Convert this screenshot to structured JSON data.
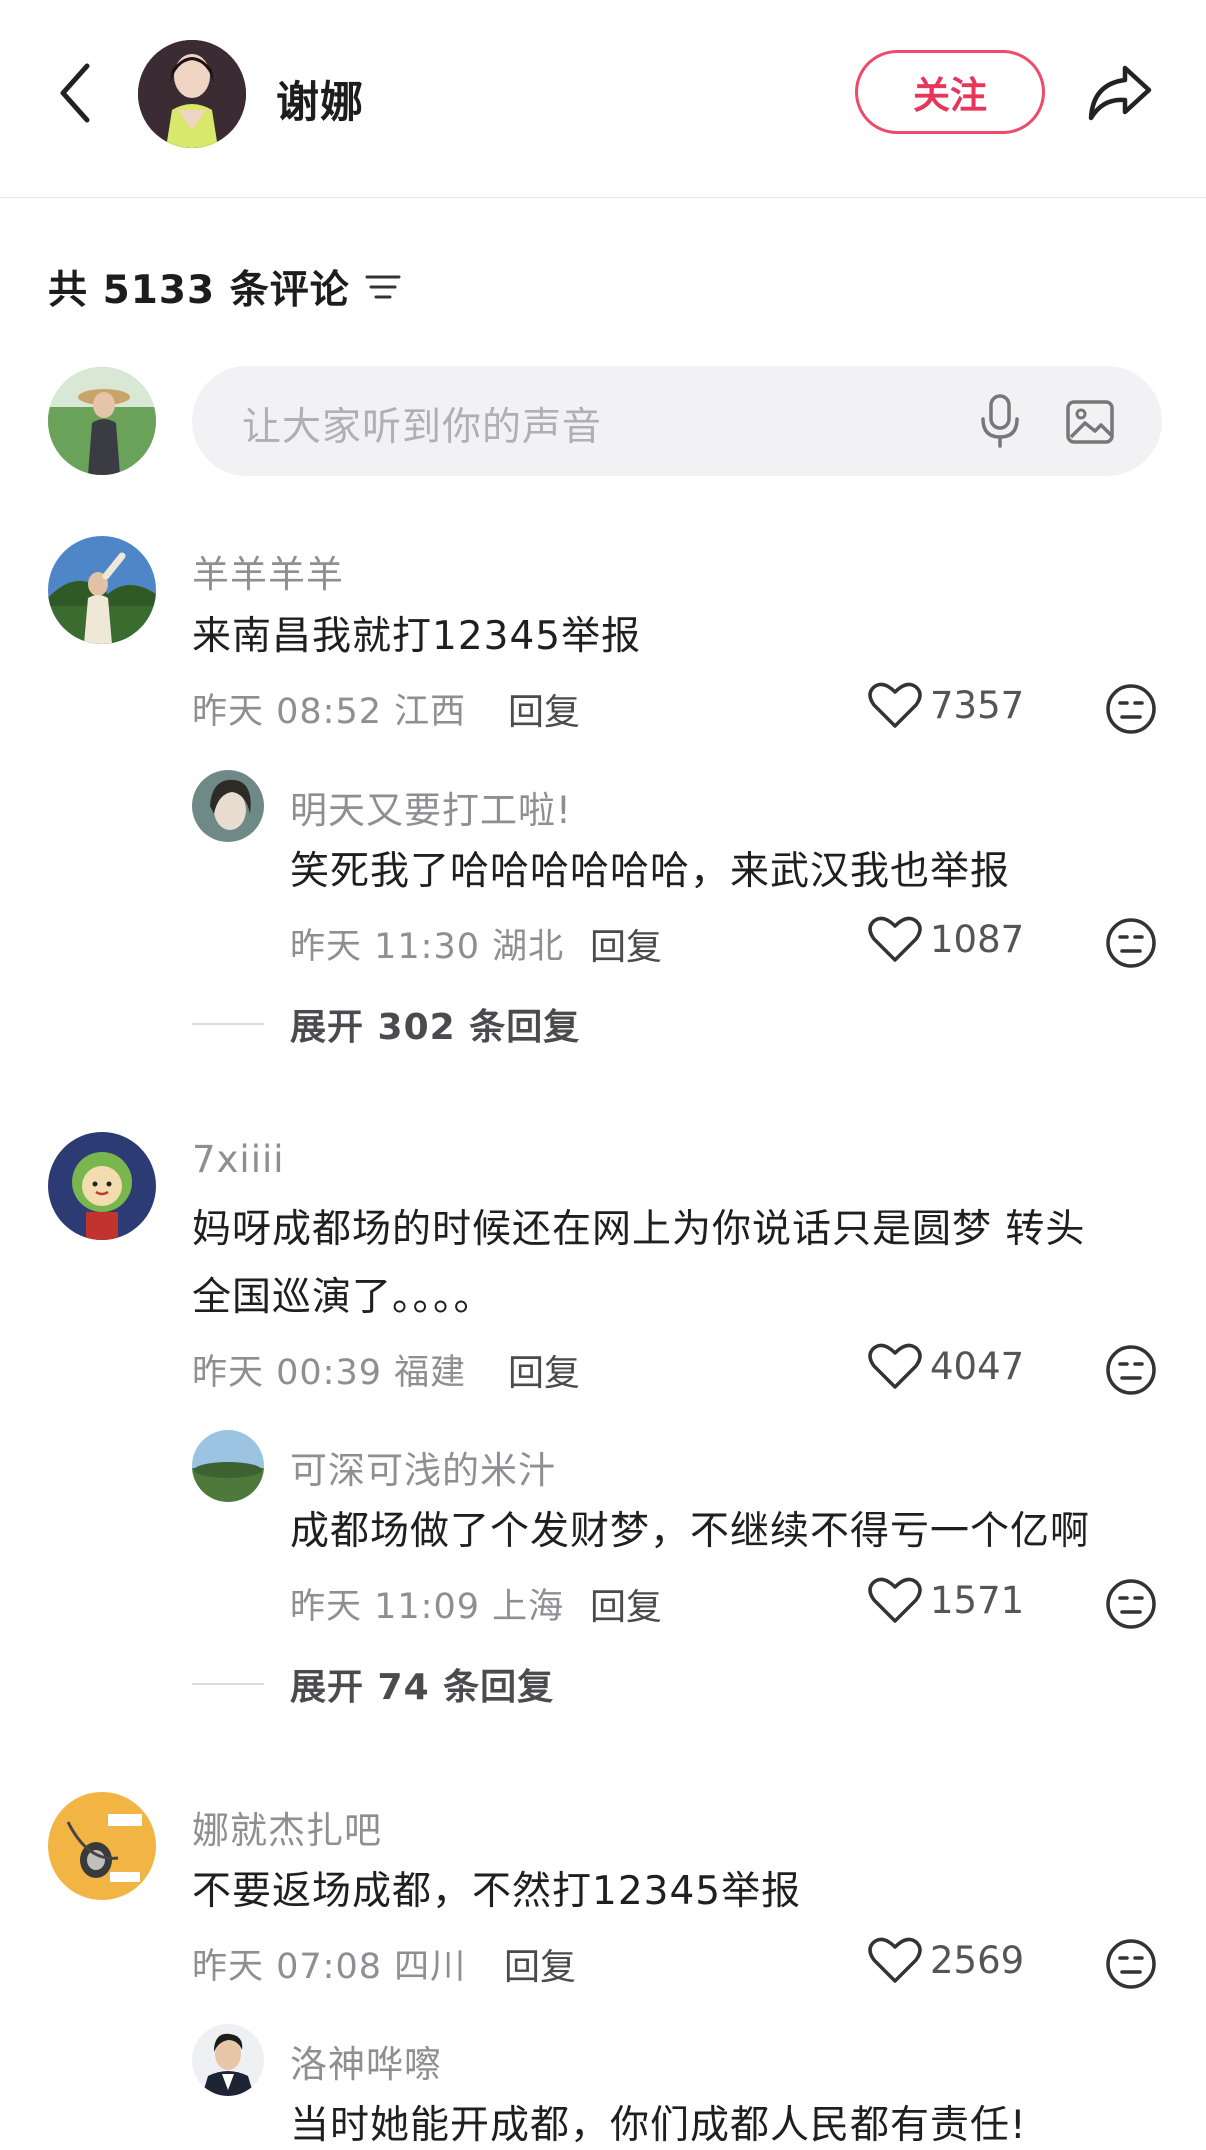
{
  "header": {
    "title": "谢娜",
    "follow_label": "关注"
  },
  "comments_header": {
    "count_text": "共 5133 条评论"
  },
  "input": {
    "placeholder": "让大家听到你的声音"
  },
  "comments": [
    {
      "user": "羊羊羊羊",
      "lines": [
        "来南昌我就打12345举报"
      ],
      "meta": "昨天 08:52 江西",
      "reply_label": "回复",
      "likes": "7357",
      "replies": [
        {
          "user": "明天又要打工啦!",
          "text": "笑死我了哈哈哈哈哈哈，来武汉我也举报",
          "meta": "昨天 11:30 湖北",
          "reply_label": "回复",
          "likes": "1087"
        }
      ],
      "expand": "展开 302 条回复"
    },
    {
      "user": "7xiiii",
      "lines": [
        "妈呀成都场的时候还在网上为你说话只是圆梦 转头",
        "全国巡演了。。。。"
      ],
      "meta": "昨天 00:39 福建",
      "reply_label": "回复",
      "likes": "4047",
      "replies": [
        {
          "user": "可深可浅的米汁",
          "text": "成都场做了个发财梦，不继续不得亏一个亿啊",
          "meta": "昨天 11:09 上海",
          "reply_label": "回复",
          "likes": "1571"
        }
      ],
      "expand": "展开 74 条回复"
    },
    {
      "user": "娜就杰扎吧",
      "lines": [
        "不要返场成都，不然打12345举报"
      ],
      "meta": "昨天 07:08 四川",
      "reply_label": "回复",
      "likes": "2569",
      "replies": [
        {
          "user": "洛神哗嚓",
          "text": "当时她能开成都，你们成都人民都有责任!"
        }
      ]
    }
  ]
}
